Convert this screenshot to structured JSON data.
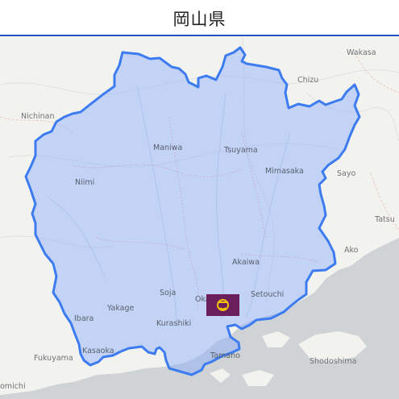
{
  "header": {
    "title": "岡山県"
  },
  "map": {
    "region_name": "岡山県",
    "colors": {
      "land": "#f2f2ef",
      "sea": "#cfd3d6",
      "boundary": "#3c7bf0",
      "fill": "#8aaaff",
      "header_rule": "#2a52be",
      "capital_marker_bg": "#6a1e5b",
      "capital_marker_symbol": "#f4c20d"
    },
    "capital_marker": {
      "icon": "okayama-prefecture-emblem"
    },
    "places": {
      "wakasa": "Wakasa",
      "chizu": "Chizu",
      "nichinan": "Nichinan",
      "maniwa": "Maniwa",
      "tsuyama": "Tsuyama",
      "mimasaka": "Mimasaka",
      "sayo": "Sayo",
      "niimi": "Niimi",
      "tatsuno": "Tatsu",
      "ako": "Ako",
      "akaiwa": "Akaiwa",
      "soja": "Soja",
      "okayama": "Okayama",
      "setouchi": "Setouchi",
      "yakage": "Yakage",
      "ibara": "Ibara",
      "kurashiki": "Kurashiki",
      "kasaoka": "Kasaoka",
      "fukuyama": "Fukuyama",
      "tamano": "Tamano",
      "shodoshima": "Shodoshima",
      "onomichi": "omichi"
    }
  }
}
